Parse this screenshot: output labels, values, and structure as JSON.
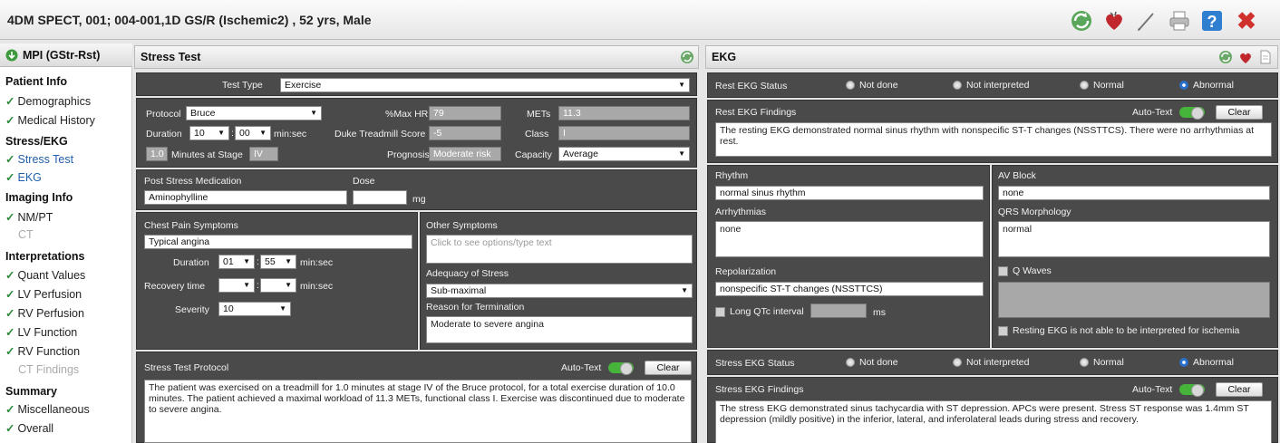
{
  "title": "4DM SPECT, 001; 004-001,1D GS/R (Ischemic2) , 52 yrs, Male",
  "toolbar": {
    "icons": [
      "refresh-icon",
      "heart-icon",
      "pen-icon",
      "printer-icon",
      "help-icon",
      "close-icon"
    ],
    "help_glyph": "?",
    "close_glyph": "✖"
  },
  "sidebar": {
    "header": "MPI (GStr-Rst)",
    "sections": {
      "patient": "Patient Info",
      "stress": "Stress/EKG",
      "imaging": "Imaging Info",
      "interp": "Interpretations",
      "summary": "Summary"
    },
    "items": {
      "demographics": "Demographics",
      "history": "Medical History",
      "stress_test": "Stress Test",
      "ekg": "EKG",
      "nmpt": "NM/PT",
      "ct": "CT",
      "quant": "Quant Values",
      "lvperf": "LV Perfusion",
      "rvperf": "RV Perfusion",
      "lvfunc": "LV Function",
      "rvfunc": "RV Function",
      "ctfind": "CT Findings",
      "misc": "Miscellaneous",
      "overall": "Overall"
    }
  },
  "stress": {
    "title": "Stress Test",
    "test_type_label": "Test Type",
    "test_type": "Exercise",
    "protocol_label": "Protocol",
    "protocol": "Bruce",
    "maxhr_label": "%Max HR",
    "maxhr": "79",
    "mets_label": "METs",
    "mets": "11.3",
    "duration_label": "Duration",
    "duration_min": "10",
    "duration_sec": "00",
    "minsec": "min:sec",
    "duke_label": "Duke Treadmill Score",
    "duke": "-5",
    "class_label": "Class",
    "class_val": "I",
    "stage_minutes": "1.0",
    "stage_label": "Minutes at Stage",
    "stage": "IV",
    "prognosis_label": "Prognosis",
    "prognosis": "Moderate risk",
    "capacity_label": "Capacity",
    "capacity": "Average",
    "med_label": "Post Stress Medication",
    "med": "Aminophylline",
    "dose_label": "Dose",
    "dose": "",
    "dose_unit": "mg",
    "chest_label": "Chest Pain Symptoms",
    "chest": "Typical angina",
    "cp_duration_label": "Duration",
    "cp_min": "01",
    "cp_sec": "55",
    "cp_minsec": "min:sec",
    "recovery_label": "Recovery time",
    "rec_min": "",
    "rec_sec": "",
    "rec_minsec": "min:sec",
    "severity_label": "Severity",
    "severity": "10",
    "other_label": "Other Symptoms",
    "other_placeholder": "Click to see options/type text",
    "adequacy_label": "Adequacy of Stress",
    "adequacy": "Sub-maximal",
    "reason_label": "Reason for Termination",
    "reason": "Moderate to severe angina",
    "protocol_text_label": "Stress Test Protocol",
    "autotext": "Auto-Text",
    "clear": "Clear",
    "protocol_text": "The patient was exercised on a treadmill for 1.0 minutes at stage IV of the Bruce protocol, for a total exercise duration of 10.0 minutes. The patient achieved a maximal workload of 11.3 METs, functional class I. Exercise was discontinued due to moderate to severe angina."
  },
  "ekg": {
    "title": "EKG",
    "rest_status_label": "Rest EKG Status",
    "opt_not_done": "Not done",
    "opt_not_interp": "Not interpreted",
    "opt_normal": "Normal",
    "opt_abnormal": "Abnormal",
    "rest_findings_label": "Rest EKG Findings",
    "autotext": "Auto-Text",
    "clear": "Clear",
    "rest_findings": "The resting EKG demonstrated normal sinus rhythm with nonspecific ST-T changes (NSSTTCS). There were no arrhythmias at rest.",
    "rhythm_label": "Rhythm",
    "rhythm": "normal sinus rhythm",
    "av_label": "AV Block",
    "av": "none",
    "arrhythmias_label": "Arrhythmias",
    "arrhythmias": "none",
    "qrs_label": "QRS Morphology",
    "qrs": "normal",
    "repol_label": "Repolarization",
    "repol": "nonspecific ST-T changes (NSSTTCS)",
    "qwaves_label": "Q Waves",
    "longqtc_label": "Long QTc interval",
    "qtc": "",
    "ms": "ms",
    "resting_not_label": "Resting EKG is not able to be interpreted for ischemia",
    "stress_status_label": "Stress EKG Status",
    "stress_findings_label": "Stress EKG Findings",
    "stress_findings": "The stress EKG demonstrated sinus tachycardia with ST depression. APCs were present. Stress ST response was 1.4mm ST depression (mildly positive) in the inferior, lateral, and inferolateral leads during stress and recovery."
  }
}
